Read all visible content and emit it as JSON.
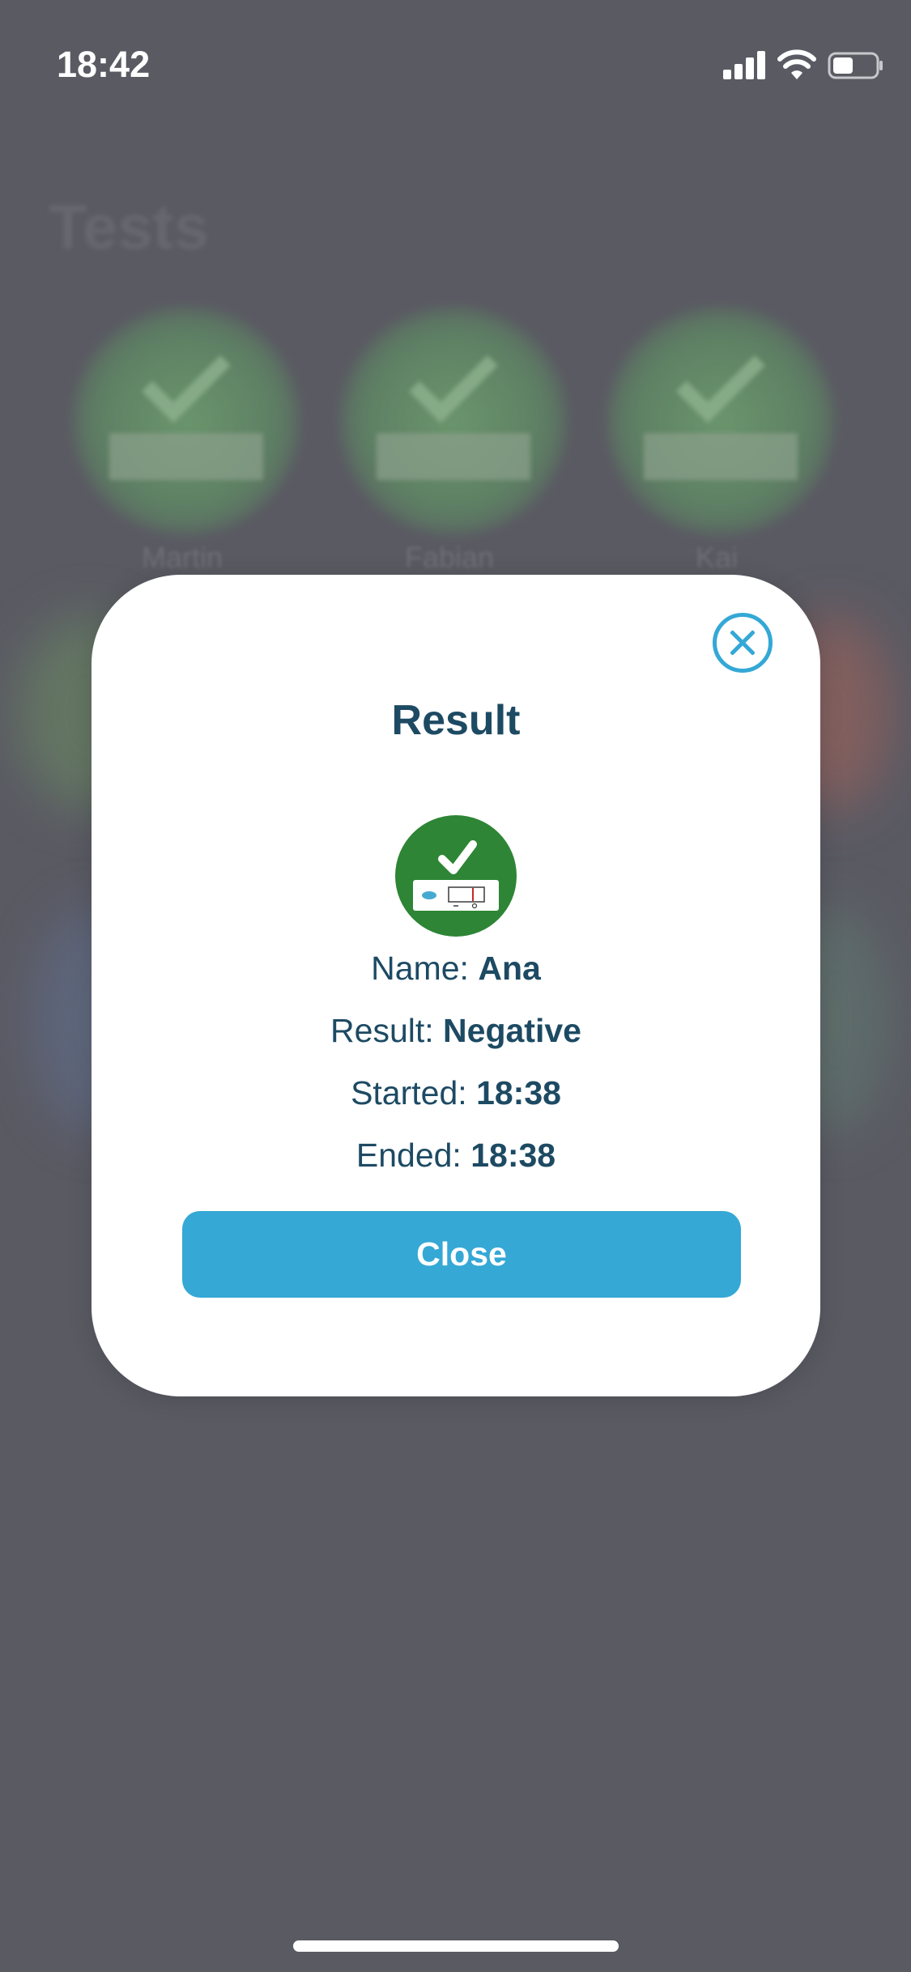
{
  "status_bar": {
    "time": "18:42"
  },
  "background": {
    "page_title": "Tests",
    "people": [
      "Martin",
      "Fabian",
      "Kai"
    ]
  },
  "modal": {
    "title": "Result",
    "name_label": "Name:",
    "name_value": "Ana",
    "result_label": "Result:",
    "result_value": "Negative",
    "started_label": "Started:",
    "started_value": "18:38",
    "ended_label": "Ended:",
    "ended_value": "18:38",
    "close_button": "Close"
  },
  "colors": {
    "overlay": "#5a5a63",
    "accent": "#35a8d5",
    "text": "#1d4a63",
    "success": "#2e8535"
  },
  "icons": {
    "result": "test-negative-check-icon",
    "dismiss": "close-circle-icon"
  }
}
